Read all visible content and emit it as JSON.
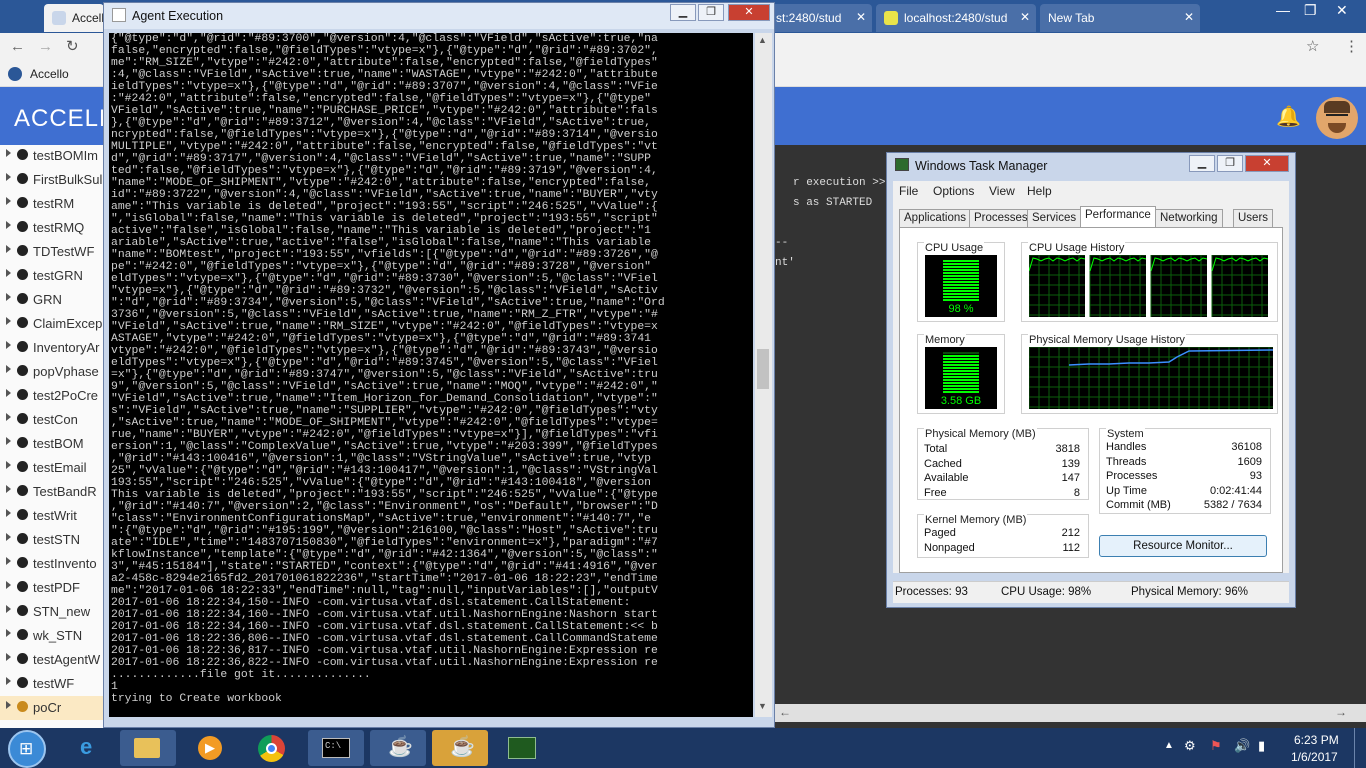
{
  "chrome": {
    "tabs": [
      {
        "label": "Accello"
      },
      {
        "label": "st:2480/stud"
      },
      {
        "label": "localhost:2480/stud"
      },
      {
        "label": "New Tab"
      }
    ],
    "bookmark_label": "Accello"
  },
  "app": {
    "title": "ACCELLO",
    "sidebar_items": [
      "testBOMIm",
      "FirstBulkSul",
      "testRM",
      "testRMQ",
      "TDTestWF",
      "testGRN",
      "GRN",
      "ClaimExcep",
      "InventoryAr",
      "popVphase",
      "test2PoCre",
      "testCon",
      "testBOM",
      "testEmail",
      "TestBandR",
      "testWrit",
      "testSTN",
      "testInvento",
      "testPDF",
      "STN_new",
      "wk_STN",
      "testAgentW",
      "testWF",
      "poCr"
    ],
    "console_snippets": [
      "r execution >>>",
      "s as STARTED",
      "--",
      "nt'"
    ]
  },
  "console": {
    "title": "Agent Execution",
    "lines": [
      "{\"@type\":\"d\",\"@rid\":\"#89:3700\",\"@version\":4,\"@class\":\"VField\",\"sActive\":true,\"na",
      "false,\"encrypted\":false,\"@fieldTypes\":\"vtype=x\"},{\"@type\":\"d\",\"@rid\":\"#89:3702\",",
      "me\":\"RM_SIZE\",\"vtype\":\"#242:0\",\"attribute\":false,\"encrypted\":false,\"@fieldTypes\"",
      ":4,\"@class\":\"VField\",\"sActive\":true,\"name\":\"WASTAGE\",\"vtype\":\"#242:0\",\"attribute",
      "ieldTypes\":\"vtype=x\"},{\"@type\":\"d\",\"@rid\":\"#89:3707\",\"@version\":4,\"@class\":\"VFie",
      ":\"#242:0\",\"attribute\":false,\"encrypted\":false,\"@fieldTypes\":\"vtype=x\"},{\"@type\"",
      "VField\",\"sActive\":true,\"name\":\"PURCHASE_PRICE\",\"vtype\":\"#242:0\",\"attribute\":fals",
      "},{\"@type\":\"d\",\"@rid\":\"#89:3712\",\"@version\":4,\"@class\":\"VField\",\"sActive\":true,",
      "ncrypted\":false,\"@fieldTypes\":\"vtype=x\"},{\"@type\":\"d\",\"@rid\":\"#89:3714\",\"@versio",
      "MULTIPLE\",\"vtype\":\"#242:0\",\"attribute\":false,\"encrypted\":false,\"@fieldTypes\":\"vt",
      "d\",\"@rid\":\"#89:3717\",\"@version\":4,\"@class\":\"VField\",\"sActive\":true,\"name\":\"SUPP",
      "ted\":false,\"@fieldTypes\":\"vtype=x\"},{\"@type\":\"d\",\"@rid\":\"#89:3719\",\"@version\":4,",
      "\"name\":\"MODE_OF_SHIPMENT\",\"vtype\":\"#242:0\",\"attribute\":false,\"encrypted\":false,",
      "id\":\"#89:3722\",\"@version\":4,\"@class\":\"VField\",\"sActive\":true,\"name\":\"BUYER\",\"vty",
      "ame\":\"This variable is deleted\",\"project\":\"193:55\",\"script\":\"246:525\",\"vValue\":{",
      "\",\"isGlobal\":false,\"name\":\"This variable is deleted\",\"project\":\"193:55\",\"script\"",
      "active\":\"false\",\"isGlobal\":false,\"name\":\"This variable is deleted\",\"project\":\"1",
      "ariable\",\"sActive\":true,\"active\":\"false\",\"isGlobal\":false,\"name\":\"This variable",
      "\"name\":\"BOMtest\",\"project\":\"193:55\",\"vfields\":[{\"@type\":\"d\",\"@rid\":\"#89:3726\",\"@",
      "pe\":\"#242:0\",\"@fieldTypes\":\"vtype=x\"},{\"@type\":\"d\",\"@rid\":\"#89:3728\",\"@version\"",
      "eldTypes\":\"vtype=x\"},{\"@type\":\"d\",\"@rid\":\"#89:3730\",\"@version\":5,\"@class\":\"VFiel",
      "\"vtype=x\"},{\"@type\":\"d\",\"@rid\":\"#89:3732\",\"@version\":5,\"@class\":\"VField\",\"sActiv",
      "\":\"d\",\"@rid\":\"#89:3734\",\"@version\":5,\"@class\":\"VField\",\"sActive\":true,\"name\":\"Ord",
      "3736\",\"@version\":5,\"@class\":\"VField\",\"sActive\":true,\"name\":\"RM_Z_FTR\",\"vtype\":\"#",
      "\"VField\",\"sActive\":true,\"name\":\"RM_SIZE\",\"vtype\":\"#242:0\",\"@fieldTypes\":\"vtype=x",
      "ASTAGE\",\"vtype\":\"#242:0\",\"@fieldTypes\":\"vtype=x\"},{\"@type\":\"d\",\"@rid\":\"#89:3741",
      "vtype\":\"#242:0\",\"@fieldTypes\":\"vtype=x\"},{\"@type\":\"d\",\"@rid\":\"#89:3743\",\"@versio",
      "eldTypes\":\"vtype=x\"},{\"@type\":\"d\",\"@rid\":\"#89:3745\",\"@version\":5,\"@class\":\"VFiel",
      "=x\"},{\"@type\":\"d\",\"@rid\":\"#89:3747\",\"@version\":5,\"@class\":\"VField\",\"sActive\":tru",
      "9\",\"@version\":5,\"@class\":\"VField\",\"sActive\":true,\"name\":\"MOQ\",\"vtype\":\"#242:0\",\"",
      "\"VField\",\"sActive\":true,\"name\":\"Item_Horizon_for_Demand_Consolidation\",\"vtype\":\"",
      "s\":\"VField\",\"sActive\":true,\"name\":\"SUPPLIER\",\"vtype\":\"#242:0\",\"@fieldTypes\":\"vty",
      ",\"sActive\":true,\"name\":\"MODE_OF_SHIPMENT\",\"vtype\":\"#242:0\",\"@fieldTypes\":\"vtype=",
      "rue,\"name\":\"BUYER\",\"vtype\":\"#242:0\",\"@fieldTypes\":\"vtype=x\"}],\"@fieldTypes\":\"vfi",
      "ersion\":1,\"@class\":\"ComplexValue\",\"sActive\":true,\"vtype\":\"#203:399\",\"@fieldTypes",
      ",\"@rid\":\"#143:100416\",\"@version\":1,\"@class\":\"VStringValue\",\"sActive\":true,\"vtyp",
      "25\",\"vValue\":{\"@type\":\"d\",\"@rid\":\"#143:100417\",\"@version\":1,\"@class\":\"VStringVal",
      "193:55\",\"script\":\"246:525\",\"vValue\":{\"@type\":\"d\",\"@rid\":\"#143:100418\",\"@version",
      "This variable is deleted\",\"project\":\"193:55\",\"script\":\"246:525\",\"vValue\":{\"@type",
      ",\"@rid\":\"#140:7\",\"@version\":2,\"@class\":\"Environment\",\"os\":\"Default\",\"browser\":\"D",
      "\"class\":\"EnvironmentConfigurationsMap\",\"sActive\":true,\"environment\":\"#140:7\",\"e",
      "\":{\"@type\":\"d\",\"@rid\":\"#195:199\",\"@version\":216100,\"@class\":\"Host\",\"sActive\":tru",
      "ate\":\"IDLE\",\"time\":\"1483707150830\",\"@fieldTypes\":\"environment=x\"},\"paradigm\":\"#7",
      "kflowInstance\",\"template\":{\"@type\":\"d\",\"@rid\":\"#42:1364\",\"@version\":5,\"@class\":\"",
      "3\",\"#45:15184\"],\"state\":\"STARTED\",\"context\":{\"@type\":\"d\",\"@rid\":\"#41:4916\",\"@ver",
      "a2-458c-8294e2165fd2_201701061822236\",\"startTime\":\"2017-01-06 18:22:23\",\"endTime",
      "me\":\"2017-01-06 18:22:33\",\"endTime\":null,\"tag\":null,\"inputVariables\":[],\"outputV",
      "2017-01-06 18:22:34,150--INFO -com.virtusa.vtaf.dsl.statement.CallStatement:",
      "2017-01-06 18:22:34,160--INFO -com.virtusa.vtaf.util.NashornEngine:Nashorn start",
      "2017-01-06 18:22:34,160--INFO -com.virtusa.vtaf.dsl.statement.CallStatement:<< b",
      "2017-01-06 18:22:36,806--INFO -com.virtusa.vtaf.dsl.statement.CallCommandStateme",
      "2017-01-06 18:22:36,817--INFO -com.virtusa.vtaf.util.NashornEngine:Expression re",
      "2017-01-06 18:22:36,822--INFO -com.virtusa.vtaf.util.NashornEngine:Expression re",
      ".............file got it..............",
      "1",
      "trying to Create workbook"
    ]
  },
  "task_manager": {
    "title": "Windows Task Manager",
    "menu": [
      "File",
      "Options",
      "View",
      "Help"
    ],
    "tabs": [
      "Applications",
      "Processes",
      "Services",
      "Performance",
      "Networking",
      "Users"
    ],
    "active_tab": "Performance",
    "cpu_usage_label": "CPU Usage",
    "cpu_usage_value": "98 %",
    "cpu_history_label": "CPU Usage History",
    "memory_label": "Memory",
    "memory_value": "3.58 GB",
    "mem_history_label": "Physical Memory Usage History",
    "physical_memory": {
      "title": "Physical Memory (MB)",
      "rows": [
        {
          "label": "Total",
          "value": "3818"
        },
        {
          "label": "Cached",
          "value": "139"
        },
        {
          "label": "Available",
          "value": "147"
        },
        {
          "label": "Free",
          "value": "8"
        }
      ]
    },
    "kernel_memory": {
      "title": "Kernel Memory (MB)",
      "rows": [
        {
          "label": "Paged",
          "value": "212"
        },
        {
          "label": "Nonpaged",
          "value": "112"
        }
      ]
    },
    "system": {
      "title": "System",
      "rows": [
        {
          "label": "Handles",
          "value": "36108"
        },
        {
          "label": "Threads",
          "value": "1609"
        },
        {
          "label": "Processes",
          "value": "93"
        },
        {
          "label": "Up Time",
          "value": "0:02:41:44"
        },
        {
          "label": "Commit (MB)",
          "value": "5382 / 7634"
        }
      ]
    },
    "resource_monitor_button": "Resource Monitor...",
    "status": {
      "processes": "Processes: 93",
      "cpu": "CPU Usage: 98%",
      "memory": "Physical Memory: 96%"
    }
  },
  "taskbar": {
    "time": "6:23 PM",
    "date": "1/6/2017"
  },
  "colors": {
    "app_header": "#3f6fd1",
    "console_bg": "#000000",
    "graph_green": "#00ff00",
    "graph_bg": "#000000",
    "taskbar": "#1c3763"
  }
}
